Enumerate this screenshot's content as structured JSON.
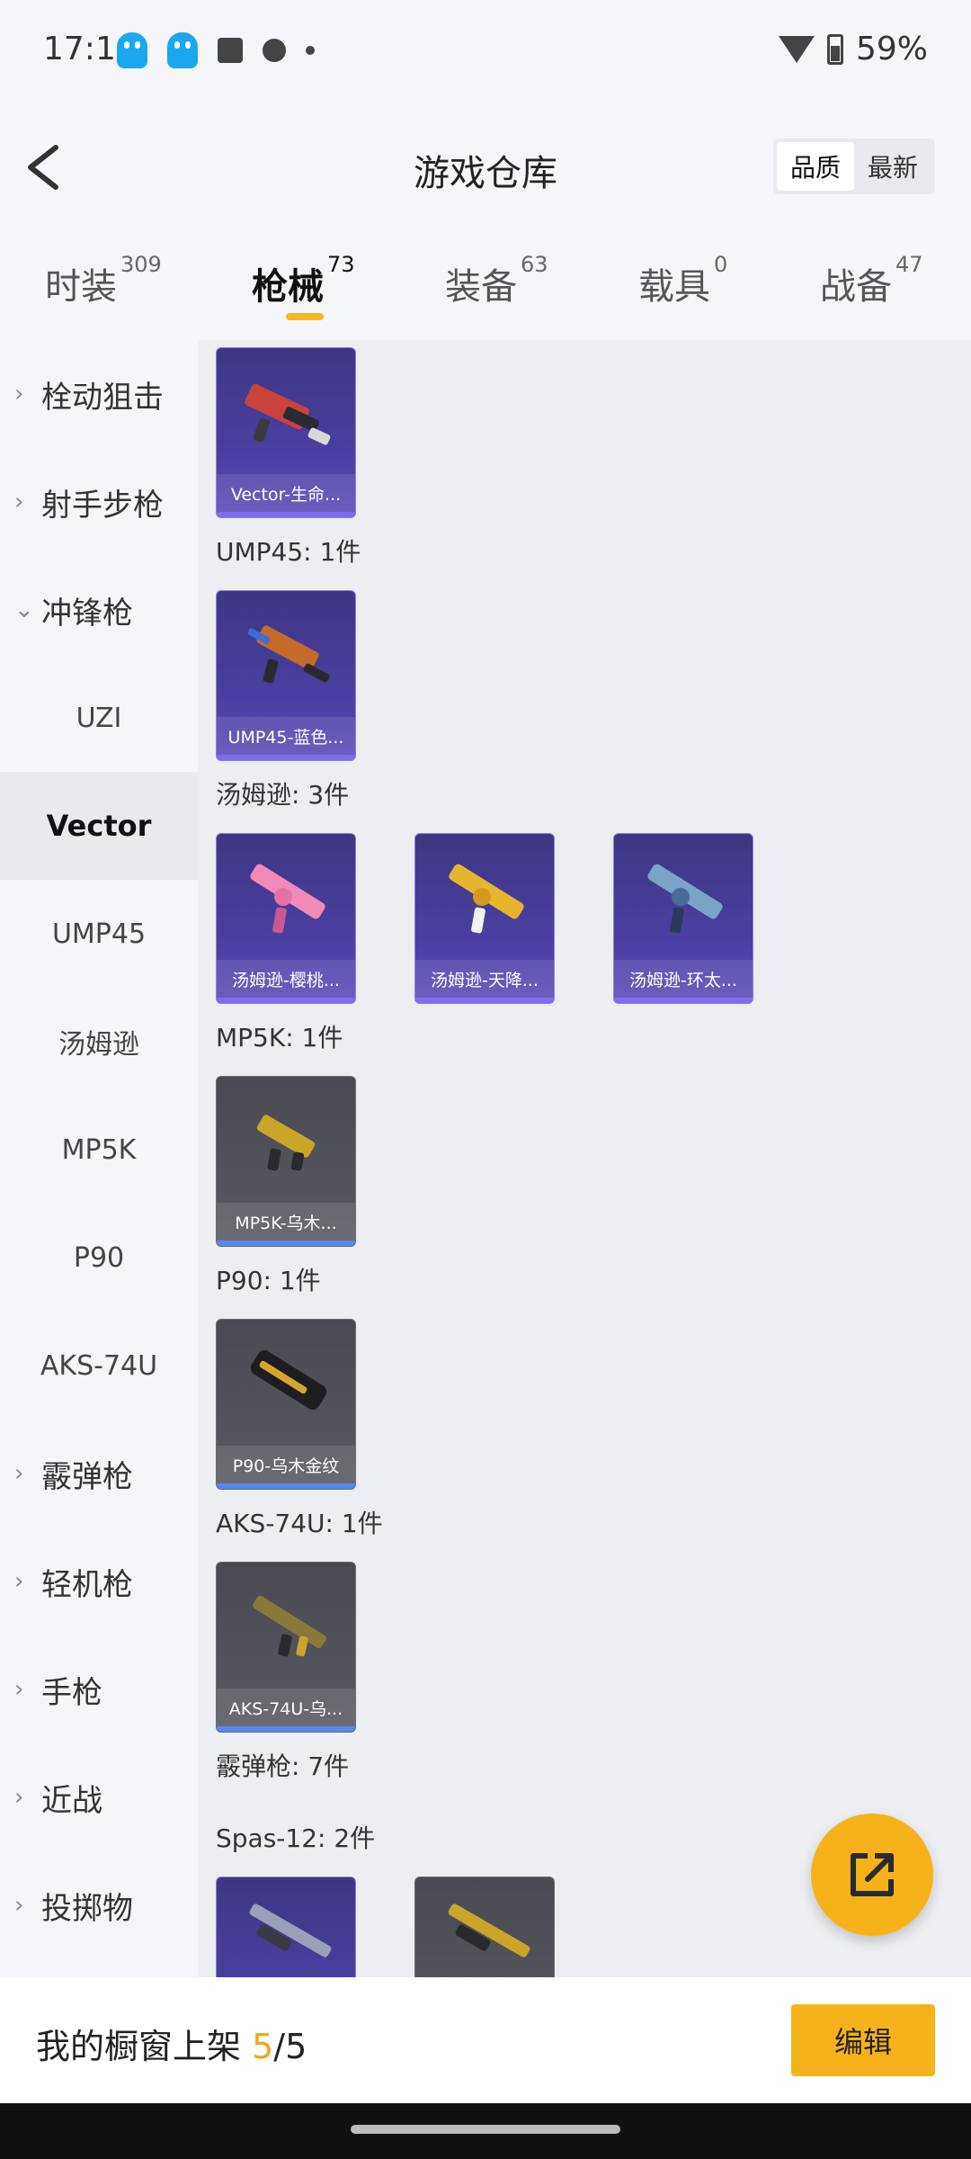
{
  "status_bar": {
    "time": "17:16",
    "battery": "59%",
    "icons": [
      "qq-icon",
      "qq-icon",
      "mail-icon",
      "motorola-icon",
      "notification-dot-icon",
      "wifi-icon",
      "battery-icon"
    ]
  },
  "header": {
    "title": "游戏仓库",
    "sort_options": [
      "品质",
      "最新"
    ],
    "sort_selected": "品质"
  },
  "tabs": [
    {
      "label": "时装",
      "count": "309"
    },
    {
      "label": "枪械",
      "count": "73",
      "active": true
    },
    {
      "label": "装备",
      "count": "63"
    },
    {
      "label": "载具",
      "count": "0"
    },
    {
      "label": "战备",
      "count": "47"
    }
  ],
  "sidebar": {
    "items": [
      {
        "label": "栓动狙击",
        "expandable": true
      },
      {
        "label": "射手步枪",
        "expandable": true
      },
      {
        "label": "冲锋枪",
        "expanded": true
      },
      {
        "label": "UZI",
        "sub": true
      },
      {
        "label": "Vector",
        "sub": true,
        "selected": true
      },
      {
        "label": "UMP45",
        "sub": true
      },
      {
        "label": "汤姆逊",
        "sub": true
      },
      {
        "label": "MP5K",
        "sub": true
      },
      {
        "label": "P90",
        "sub": true
      },
      {
        "label": "AKS-74U",
        "sub": true
      },
      {
        "label": "霰弹枪",
        "expandable": true
      },
      {
        "label": "轻机枪",
        "expandable": true
      },
      {
        "label": "手枪",
        "expandable": true
      },
      {
        "label": "近战",
        "expandable": true
      },
      {
        "label": "投掷物",
        "expandable": true
      }
    ]
  },
  "content": {
    "groups": [
      {
        "label": "",
        "items": [
          {
            "name": "Vector-生命...",
            "rarity": "purple"
          }
        ]
      },
      {
        "label": "UMP45: 1件",
        "items": [
          {
            "name": "UMP45-蓝色...",
            "rarity": "purple"
          }
        ]
      },
      {
        "label": "汤姆逊: 3件",
        "items": [
          {
            "name": "汤姆逊-樱桃...",
            "rarity": "purple"
          },
          {
            "name": "汤姆逊-天降...",
            "rarity": "purple"
          },
          {
            "name": "汤姆逊-环太...",
            "rarity": "purple"
          }
        ]
      },
      {
        "label": "MP5K: 1件",
        "items": [
          {
            "name": "MP5K-乌木...",
            "rarity": "gray"
          }
        ]
      },
      {
        "label": "P90: 1件",
        "items": [
          {
            "name": "P90-乌木金纹",
            "rarity": "gray"
          }
        ]
      },
      {
        "label": "AKS-74U: 1件",
        "items": [
          {
            "name": "AKS-74U-乌...",
            "rarity": "gray"
          }
        ]
      },
      {
        "label": "霰弹枪: 7件",
        "items": []
      },
      {
        "label": "Spas-12: 2件",
        "items": [
          {
            "name": "",
            "rarity": "purple"
          },
          {
            "name": "",
            "rarity": "gray"
          }
        ]
      }
    ]
  },
  "bottom_bar": {
    "text": "我的橱窗上架 ",
    "count": "5",
    "total": "/5",
    "edit_label": "编辑"
  },
  "colors": {
    "accent": "#f6b21a",
    "purple_card": "#4a3fa0",
    "gray_card": "#55555d"
  }
}
